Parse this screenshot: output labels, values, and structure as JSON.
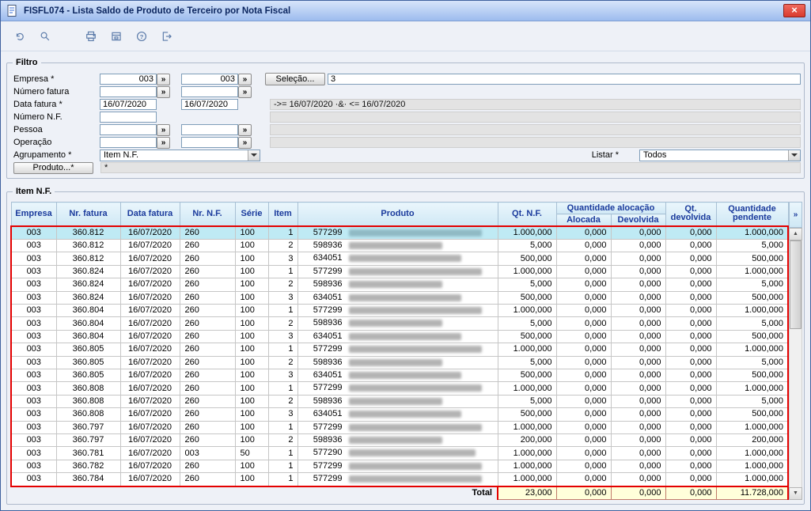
{
  "window": {
    "title": "FISFL074 - Lista Saldo de Produto de Terceiro por Nota Fiscal",
    "close_label": "×"
  },
  "toolbar": {
    "icons": [
      "undo-icon",
      "search-icon",
      "print-icon",
      "save-icon",
      "help-icon",
      "exit-icon"
    ]
  },
  "filter": {
    "legend": "Filtro",
    "lookup_button": "»",
    "selecao": {
      "button": "Seleção...",
      "value": "3"
    },
    "rows": {
      "empresa": {
        "label": "Empresa *",
        "from": "003",
        "to": "003"
      },
      "numero_fatura": {
        "label": "Número fatura",
        "from": "",
        "to": ""
      },
      "data_fatura": {
        "label": "Data fatura *",
        "from": "16/07/2020",
        "to": "16/07/2020",
        "range_text": "->= 16/07/2020  ·&·  <= 16/07/2020"
      },
      "numero_nf": {
        "label": "Número N.F.",
        "value": ""
      },
      "pessoa": {
        "label": "Pessoa",
        "from": "",
        "to": ""
      },
      "operacao": {
        "label": "Operação",
        "from": "",
        "to": ""
      },
      "agrupamento": {
        "label": "Agrupamento *",
        "value": "Item N.F."
      },
      "listar": {
        "label": "Listar *",
        "value": "Todos"
      },
      "produto": {
        "button": "Produto...*",
        "value": "*"
      }
    }
  },
  "grid": {
    "legend": "Item N.F.",
    "more_button": "»",
    "headers": {
      "empresa": "Empresa",
      "nr_fatura": "Nr. fatura",
      "data_fatura": "Data fatura",
      "nr_nf": "Nr. N.F.",
      "serie": "Série",
      "item": "Item",
      "produto": "Produto",
      "qt_nf": "Qt. N.F.",
      "alocacao_group": "Quantidade alocação",
      "alocada": "Alocada",
      "devolvida": "Devolvida",
      "qt_devolvida": "Qt.\ndevolvida",
      "pendente": "Quantidade\npendente"
    },
    "rows": [
      [
        "003",
        "360.812",
        "16/07/2020",
        "260",
        "100",
        "1",
        "577299",
        "1.000,000",
        "0,000",
        "0,000",
        "0,000",
        "1.000,000"
      ],
      [
        "003",
        "360.812",
        "16/07/2020",
        "260",
        "100",
        "2",
        "598936",
        "5,000",
        "0,000",
        "0,000",
        "0,000",
        "5,000"
      ],
      [
        "003",
        "360.812",
        "16/07/2020",
        "260",
        "100",
        "3",
        "634051",
        "500,000",
        "0,000",
        "0,000",
        "0,000",
        "500,000"
      ],
      [
        "003",
        "360.824",
        "16/07/2020",
        "260",
        "100",
        "1",
        "577299",
        "1.000,000",
        "0,000",
        "0,000",
        "0,000",
        "1.000,000"
      ],
      [
        "003",
        "360.824",
        "16/07/2020",
        "260",
        "100",
        "2",
        "598936",
        "5,000",
        "0,000",
        "0,000",
        "0,000",
        "5,000"
      ],
      [
        "003",
        "360.824",
        "16/07/2020",
        "260",
        "100",
        "3",
        "634051",
        "500,000",
        "0,000",
        "0,000",
        "0,000",
        "500,000"
      ],
      [
        "003",
        "360.804",
        "16/07/2020",
        "260",
        "100",
        "1",
        "577299",
        "1.000,000",
        "0,000",
        "0,000",
        "0,000",
        "1.000,000"
      ],
      [
        "003",
        "360.804",
        "16/07/2020",
        "260",
        "100",
        "2",
        "598936",
        "5,000",
        "0,000",
        "0,000",
        "0,000",
        "5,000"
      ],
      [
        "003",
        "360.804",
        "16/07/2020",
        "260",
        "100",
        "3",
        "634051",
        "500,000",
        "0,000",
        "0,000",
        "0,000",
        "500,000"
      ],
      [
        "003",
        "360.805",
        "16/07/2020",
        "260",
        "100",
        "1",
        "577299",
        "1.000,000",
        "0,000",
        "0,000",
        "0,000",
        "1.000,000"
      ],
      [
        "003",
        "360.805",
        "16/07/2020",
        "260",
        "100",
        "2",
        "598936",
        "5,000",
        "0,000",
        "0,000",
        "0,000",
        "5,000"
      ],
      [
        "003",
        "360.805",
        "16/07/2020",
        "260",
        "100",
        "3",
        "634051",
        "500,000",
        "0,000",
        "0,000",
        "0,000",
        "500,000"
      ],
      [
        "003",
        "360.808",
        "16/07/2020",
        "260",
        "100",
        "1",
        "577299",
        "1.000,000",
        "0,000",
        "0,000",
        "0,000",
        "1.000,000"
      ],
      [
        "003",
        "360.808",
        "16/07/2020",
        "260",
        "100",
        "2",
        "598936",
        "5,000",
        "0,000",
        "0,000",
        "0,000",
        "5,000"
      ],
      [
        "003",
        "360.808",
        "16/07/2020",
        "260",
        "100",
        "3",
        "634051",
        "500,000",
        "0,000",
        "0,000",
        "0,000",
        "500,000"
      ],
      [
        "003",
        "360.797",
        "16/07/2020",
        "260",
        "100",
        "1",
        "577299",
        "1.000,000",
        "0,000",
        "0,000",
        "0,000",
        "1.000,000"
      ],
      [
        "003",
        "360.797",
        "16/07/2020",
        "260",
        "100",
        "2",
        "598936",
        "200,000",
        "0,000",
        "0,000",
        "0,000",
        "200,000"
      ],
      [
        "003",
        "360.781",
        "16/07/2020",
        "003",
        "50",
        "1",
        "577290",
        "1.000,000",
        "0,000",
        "0,000",
        "0,000",
        "1.000,000"
      ],
      [
        "003",
        "360.782",
        "16/07/2020",
        "260",
        "100",
        "1",
        "577299",
        "1.000,000",
        "0,000",
        "0,000",
        "0,000",
        "1.000,000"
      ],
      [
        "003",
        "360.784",
        "16/07/2020",
        "260",
        "100",
        "1",
        "577299",
        "1.000,000",
        "0,000",
        "0,000",
        "0,000",
        "1.000,000"
      ]
    ],
    "total": {
      "label": "Total",
      "qt_nf": "23,000",
      "alocada": "0,000",
      "devolvida": "0,000",
      "qt_devolvida": "0,000",
      "pendente": "11.728,000"
    }
  }
}
